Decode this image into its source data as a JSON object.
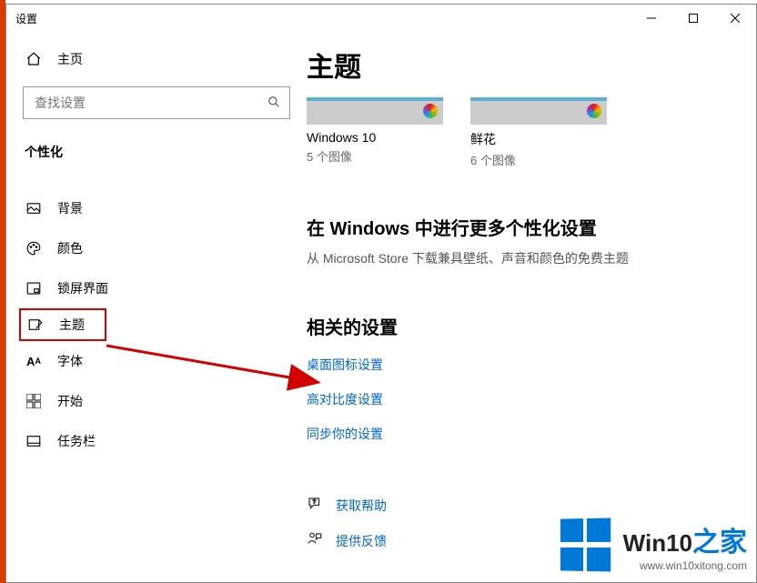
{
  "window": {
    "title": "设置"
  },
  "sidebar": {
    "home": "主页",
    "searchPlaceholder": "查找设置",
    "section": "个性化",
    "items": [
      {
        "label": "背景"
      },
      {
        "label": "颜色"
      },
      {
        "label": "锁屏界面"
      },
      {
        "label": "主题"
      },
      {
        "label": "字体"
      },
      {
        "label": "开始"
      },
      {
        "label": "任务栏"
      }
    ]
  },
  "content": {
    "pageTitle": "主题",
    "themes": [
      {
        "name": "Windows 10",
        "count": "5 个图像"
      },
      {
        "name": "鲜花",
        "count": "6 个图像"
      }
    ],
    "moreHeading": "在 Windows 中进行更多个性化设置",
    "moreSub": "从 Microsoft Store 下载兼具壁纸、声音和颜色的免费主题",
    "relatedHeading": "相关的设置",
    "links": {
      "desktopIcons": "桌面图标设置",
      "highContrast": "高对比度设置",
      "syncSettings": "同步你的设置"
    },
    "help": "获取帮助",
    "feedback": "提供反馈"
  },
  "watermark": {
    "brand": "Win10",
    "suffix": "之家",
    "url": "www.win10xitong.com"
  }
}
